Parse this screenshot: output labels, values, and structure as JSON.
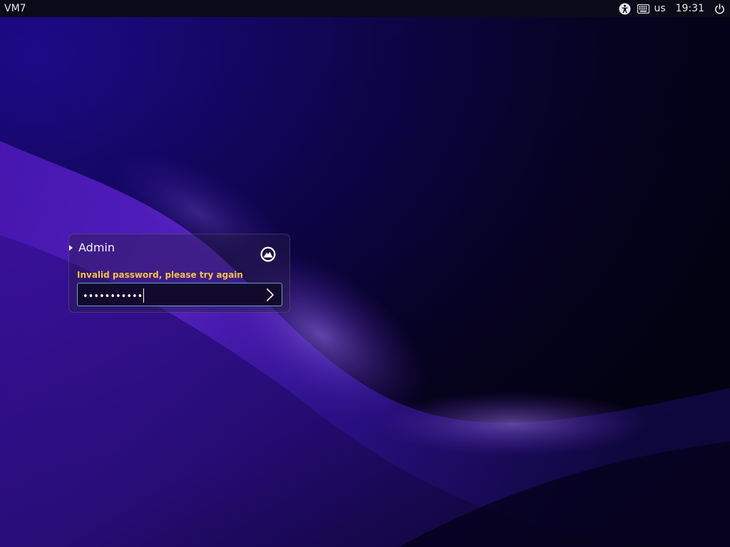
{
  "top_panel": {
    "hostname": "VM7",
    "keyboard_layout": "us",
    "clock": "19:31",
    "icons": {
      "accessibility": "accessibility-icon",
      "keyboard": "keyboard-icon",
      "power": "power-icon"
    }
  },
  "login": {
    "user_name": "Admin",
    "error_message": "Invalid password, please try again",
    "password_mask": "•••••••••••",
    "session_icon": "ubuntu-session-icon",
    "submit_icon": "chevron-right-icon"
  },
  "colors": {
    "panel_bg": "#0b0a18",
    "error": "#f5c146",
    "field_border": "#6a9bd8",
    "wallpaper_accent": "#6a2bd9"
  }
}
